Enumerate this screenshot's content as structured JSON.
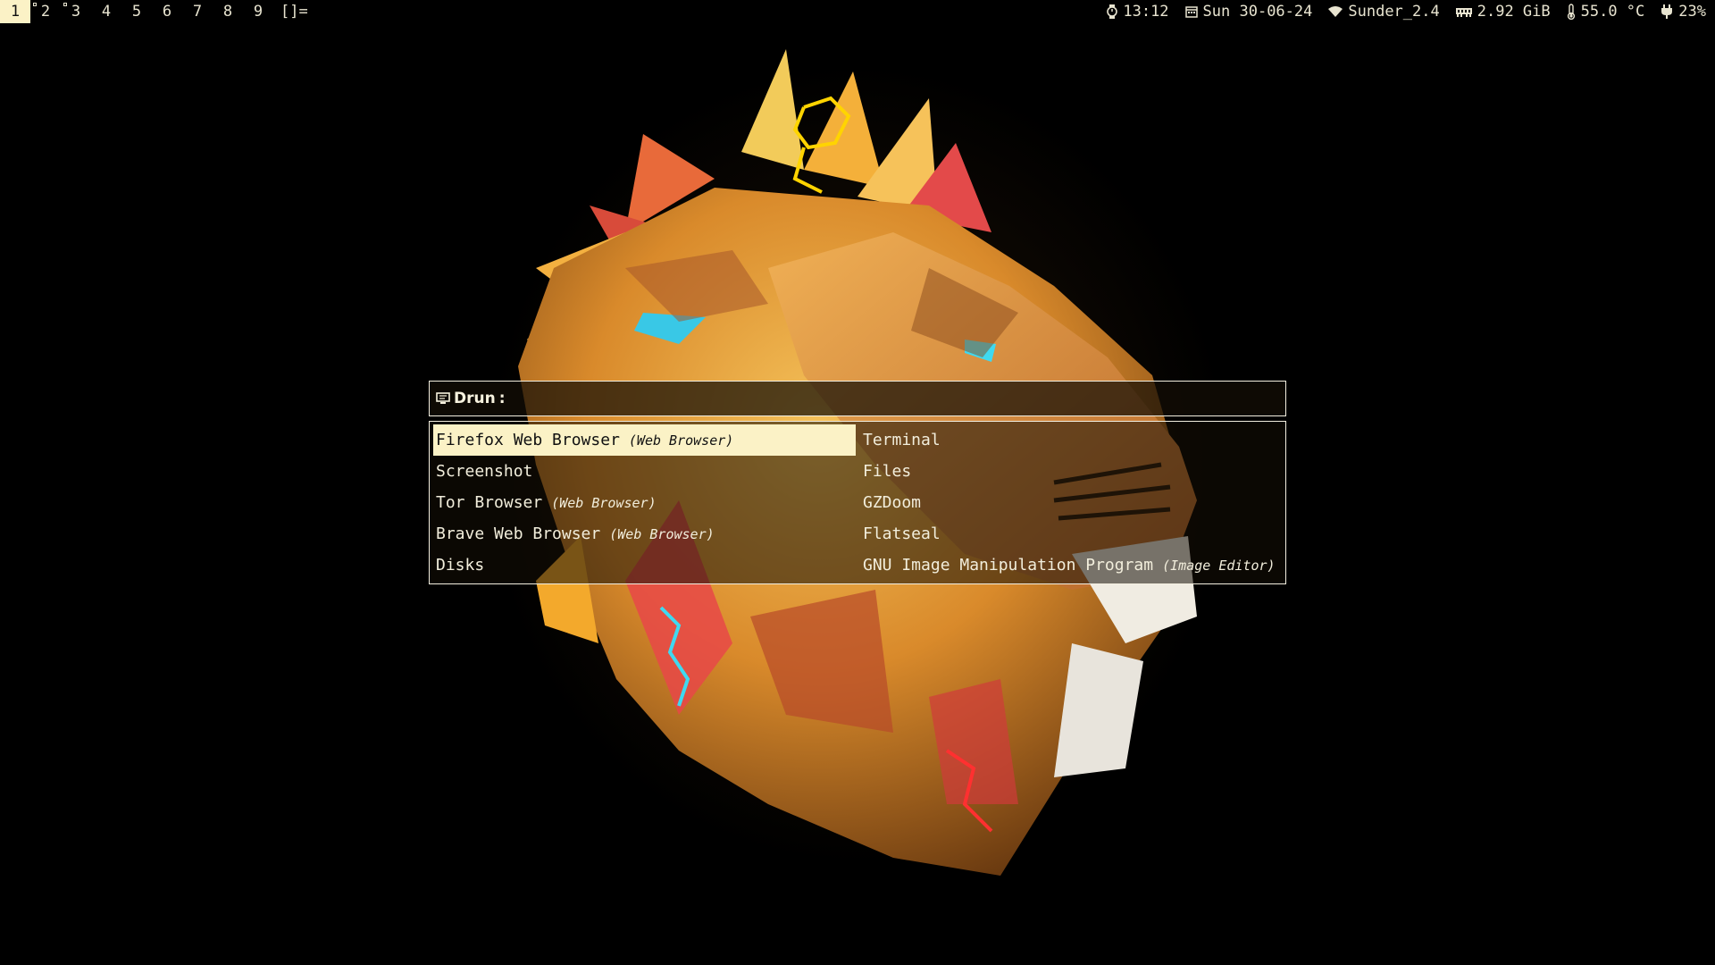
{
  "topbar": {
    "workspaces": [
      {
        "label": "1",
        "active": true,
        "occupied": false
      },
      {
        "label": "2",
        "active": false,
        "occupied": true
      },
      {
        "label": "3",
        "active": false,
        "occupied": true
      },
      {
        "label": "4",
        "active": false,
        "occupied": false
      },
      {
        "label": "5",
        "active": false,
        "occupied": false
      },
      {
        "label": "6",
        "active": false,
        "occupied": false
      },
      {
        "label": "7",
        "active": false,
        "occupied": false
      },
      {
        "label": "8",
        "active": false,
        "occupied": false
      },
      {
        "label": "9",
        "active": false,
        "occupied": false
      }
    ],
    "layout_symbol": "[]=",
    "status": {
      "time": "13:12",
      "date": "Sun 30-06-24",
      "wifi": "Sunder_2.4",
      "memory": "2.92 GiB",
      "temperature": "55.0 °C",
      "battery": "23%"
    },
    "icons": {
      "time": "clock-icon",
      "date": "calendar-icon",
      "wifi": "wifi-icon",
      "memory": "memory-icon",
      "temperature": "thermometer-icon",
      "battery": "power-plug-icon"
    }
  },
  "launcher": {
    "mode_icon": "monitor-icon",
    "mode_label": "Drun",
    "separator": ":",
    "query": "",
    "entries": [
      {
        "name": "Firefox Web Browser",
        "generic": "(Web Browser)",
        "selected": true
      },
      {
        "name": "Screenshot",
        "generic": "",
        "selected": false
      },
      {
        "name": "Tor Browser",
        "generic": "(Web Browser)",
        "selected": false
      },
      {
        "name": "Brave Web Browser",
        "generic": "(Web Browser)",
        "selected": false
      },
      {
        "name": "Disks",
        "generic": "",
        "selected": false
      },
      {
        "name": "Terminal",
        "generic": "",
        "selected": false
      },
      {
        "name": "Files",
        "generic": "",
        "selected": false
      },
      {
        "name": "GZDoom",
        "generic": "",
        "selected": false
      },
      {
        "name": "Flatseal",
        "generic": "",
        "selected": false
      },
      {
        "name": "GNU Image Manipulation Program",
        "generic": "(Image Editor)",
        "selected": false
      }
    ]
  },
  "colors": {
    "accent": "#fbf2c6",
    "foreground": "#f2eedc",
    "background": "#000000"
  }
}
